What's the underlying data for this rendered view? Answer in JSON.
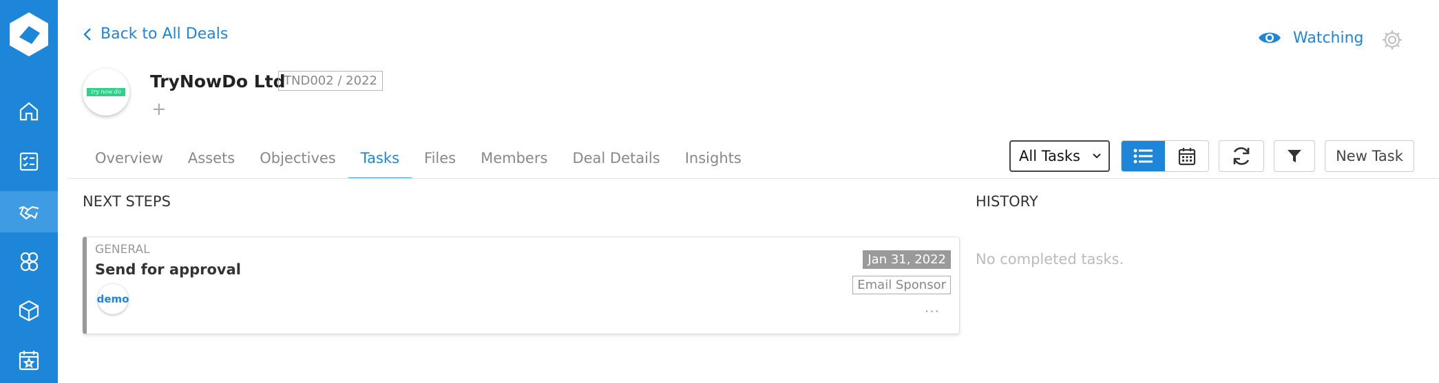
{
  "nav": {
    "back_label": "Back to All Deals",
    "watching_label": "Watching",
    "sidebar_items": [
      "home-icon",
      "checklist-icon",
      "handshake-icon",
      "people-icon",
      "box-icon",
      "calendar-star-icon"
    ]
  },
  "deal": {
    "name": "TryNowDo Ltd",
    "code": "TND002 / 2022",
    "logo_text": "try now do",
    "add_symbol": "+"
  },
  "tabs": [
    "Overview",
    "Assets",
    "Objectives",
    "Tasks",
    "Files",
    "Members",
    "Deal Details",
    "Insights"
  ],
  "active_tab": "Tasks",
  "toolbar": {
    "filter_select": "All Tasks",
    "new_task_label": "New Task"
  },
  "next_steps": {
    "title": "NEXT STEPS",
    "tasks": [
      {
        "category": "GENERAL",
        "title": "Send for approval",
        "assignee": "demo",
        "date": "Jan 31, 2022",
        "tag": "Email Sponsor",
        "more": "···"
      }
    ]
  },
  "history": {
    "title": "HISTORY",
    "empty_text": "No completed tasks."
  },
  "colors": {
    "brand": "#1e86d9",
    "sidebar_active": "#3f9be2",
    "logo_badge": "#2dd18a"
  }
}
